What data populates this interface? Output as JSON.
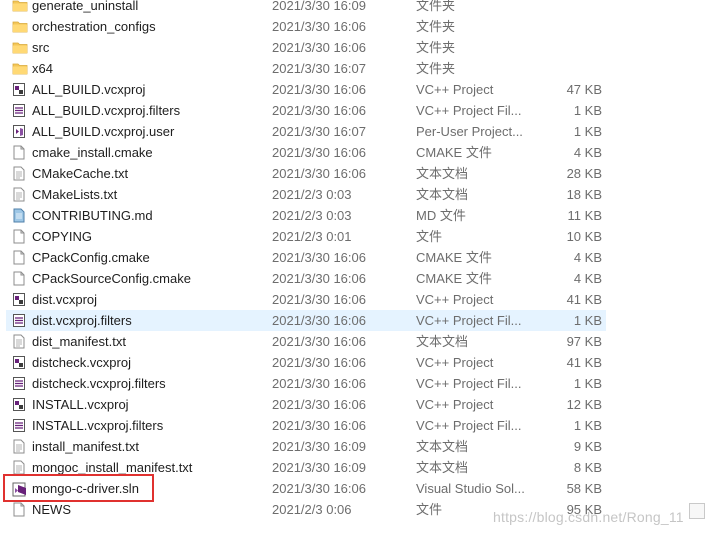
{
  "files": [
    {
      "name": "generate_uninstall",
      "date": "2021/3/30 16:09",
      "type": "文件夹",
      "size": "",
      "icon": "folder-icon"
    },
    {
      "name": "orchestration_configs",
      "date": "2021/3/30 16:06",
      "type": "文件夹",
      "size": "",
      "icon": "folder-icon"
    },
    {
      "name": "src",
      "date": "2021/3/30 16:06",
      "type": "文件夹",
      "size": "",
      "icon": "folder-icon"
    },
    {
      "name": "x64",
      "date": "2021/3/30 16:07",
      "type": "文件夹",
      "size": "",
      "icon": "folder-icon"
    },
    {
      "name": "ALL_BUILD.vcxproj",
      "date": "2021/3/30 16:06",
      "type": "VC++ Project",
      "size": "47 KB",
      "icon": "vcxproj-icon"
    },
    {
      "name": "ALL_BUILD.vcxproj.filters",
      "date": "2021/3/30 16:06",
      "type": "VC++ Project Fil...",
      "size": "1 KB",
      "icon": "filters-icon"
    },
    {
      "name": "ALL_BUILD.vcxproj.user",
      "date": "2021/3/30 16:07",
      "type": "Per-User Project...",
      "size": "1 KB",
      "icon": "vs-user-icon"
    },
    {
      "name": "cmake_install.cmake",
      "date": "2021/3/30 16:06",
      "type": "CMAKE 文件",
      "size": "4 KB",
      "icon": "document-icon"
    },
    {
      "name": "CMakeCache.txt",
      "date": "2021/3/30 16:06",
      "type": "文本文档",
      "size": "28 KB",
      "icon": "text-file-icon"
    },
    {
      "name": "CMakeLists.txt",
      "date": "2021/2/3 0:03",
      "type": "文本文档",
      "size": "18 KB",
      "icon": "text-file-icon"
    },
    {
      "name": "CONTRIBUTING.md",
      "date": "2021/2/3 0:03",
      "type": "MD 文件",
      "size": "11 KB",
      "icon": "markdown-icon"
    },
    {
      "name": "COPYING",
      "date": "2021/2/3 0:01",
      "type": "文件",
      "size": "10 KB",
      "icon": "document-icon"
    },
    {
      "name": "CPackConfig.cmake",
      "date": "2021/3/30 16:06",
      "type": "CMAKE 文件",
      "size": "4 KB",
      "icon": "document-icon"
    },
    {
      "name": "CPackSourceConfig.cmake",
      "date": "2021/3/30 16:06",
      "type": "CMAKE 文件",
      "size": "4 KB",
      "icon": "document-icon"
    },
    {
      "name": "dist.vcxproj",
      "date": "2021/3/30 16:06",
      "type": "VC++ Project",
      "size": "41 KB",
      "icon": "vcxproj-icon"
    },
    {
      "name": "dist.vcxproj.filters",
      "date": "2021/3/30 16:06",
      "type": "VC++ Project Fil...",
      "size": "1 KB",
      "icon": "filters-icon",
      "selected": true
    },
    {
      "name": "dist_manifest.txt",
      "date": "2021/3/30 16:06",
      "type": "文本文档",
      "size": "97 KB",
      "icon": "text-file-icon"
    },
    {
      "name": "distcheck.vcxproj",
      "date": "2021/3/30 16:06",
      "type": "VC++ Project",
      "size": "41 KB",
      "icon": "vcxproj-icon"
    },
    {
      "name": "distcheck.vcxproj.filters",
      "date": "2021/3/30 16:06",
      "type": "VC++ Project Fil...",
      "size": "1 KB",
      "icon": "filters-icon"
    },
    {
      "name": "INSTALL.vcxproj",
      "date": "2021/3/30 16:06",
      "type": "VC++ Project",
      "size": "12 KB",
      "icon": "vcxproj-icon"
    },
    {
      "name": "INSTALL.vcxproj.filters",
      "date": "2021/3/30 16:06",
      "type": "VC++ Project Fil...",
      "size": "1 KB",
      "icon": "filters-icon"
    },
    {
      "name": "install_manifest.txt",
      "date": "2021/3/30 16:09",
      "type": "文本文档",
      "size": "9 KB",
      "icon": "text-file-icon"
    },
    {
      "name": "mongoc_install_manifest.txt",
      "date": "2021/3/30 16:09",
      "type": "文本文档",
      "size": "8 KB",
      "icon": "text-file-icon"
    },
    {
      "name": "mongo-c-driver.sln",
      "date": "2021/3/30 16:06",
      "type": "Visual Studio Sol...",
      "size": "58 KB",
      "icon": "vs-solution-icon"
    },
    {
      "name": "NEWS",
      "date": "2021/2/3 0:06",
      "type": "文件",
      "size": "95 KB",
      "icon": "document-icon"
    }
  ],
  "highlighted_file": "mongo-c-driver.sln",
  "watermark": "https://blog.csdn.net/Rong_11",
  "colors": {
    "selection": "#e5f3ff",
    "highlight_border": "#e0312f",
    "folder": "#f3c659",
    "vs_purple": "#68217a"
  }
}
